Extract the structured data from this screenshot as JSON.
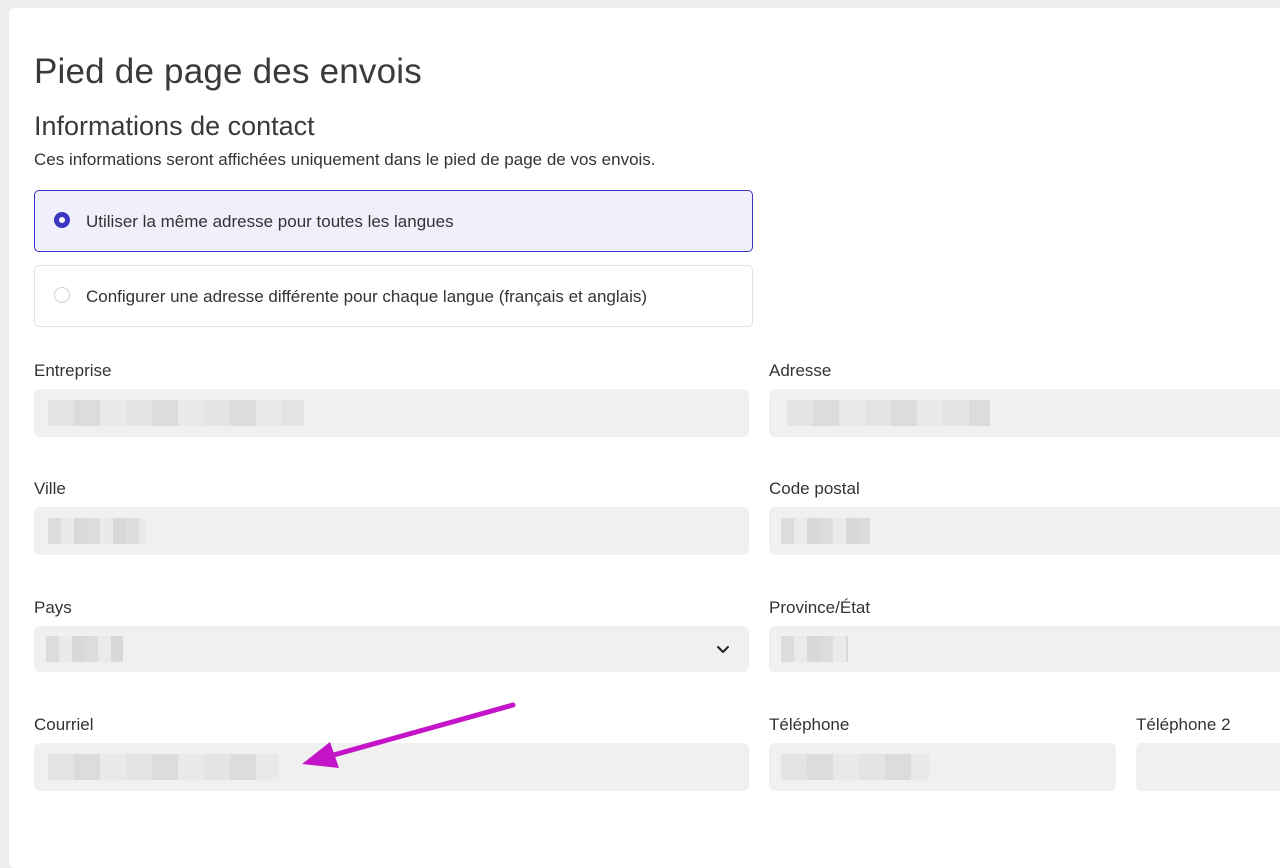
{
  "page": {
    "title": "Pied de page des envois",
    "section_title": "Informations de contact",
    "section_desc": "Ces informations seront affichées uniquement dans le pied de page de vos envois."
  },
  "address_mode": {
    "options": [
      {
        "label": "Utiliser la même adresse pour toutes les langues",
        "selected": true
      },
      {
        "label": "Configurer une adresse différente pour chaque langue (français et anglais)",
        "selected": false
      }
    ]
  },
  "form": {
    "company": {
      "label": "Entreprise",
      "value": "[masqué]"
    },
    "address": {
      "label": "Adresse",
      "value": "[masqué]"
    },
    "city": {
      "label": "Ville",
      "value": "[masqué]"
    },
    "postal_code": {
      "label": "Code postal",
      "value": "[masqué]"
    },
    "country": {
      "label": "Pays",
      "value": "[masqué]"
    },
    "province": {
      "label": "Province/État",
      "value": "[masqué]"
    },
    "email": {
      "label": "Courriel",
      "value": "[masqué]"
    },
    "phone": {
      "label": "Téléphone",
      "value": "[masqué]"
    },
    "phone2": {
      "label": "Téléphone 2",
      "value": ""
    }
  },
  "colors": {
    "accent": "#3b35c4",
    "annotation_arrow": "#c414c8",
    "field_bg": "#f0f0f0"
  },
  "icons": {
    "country_select": "chevron-down-icon"
  }
}
